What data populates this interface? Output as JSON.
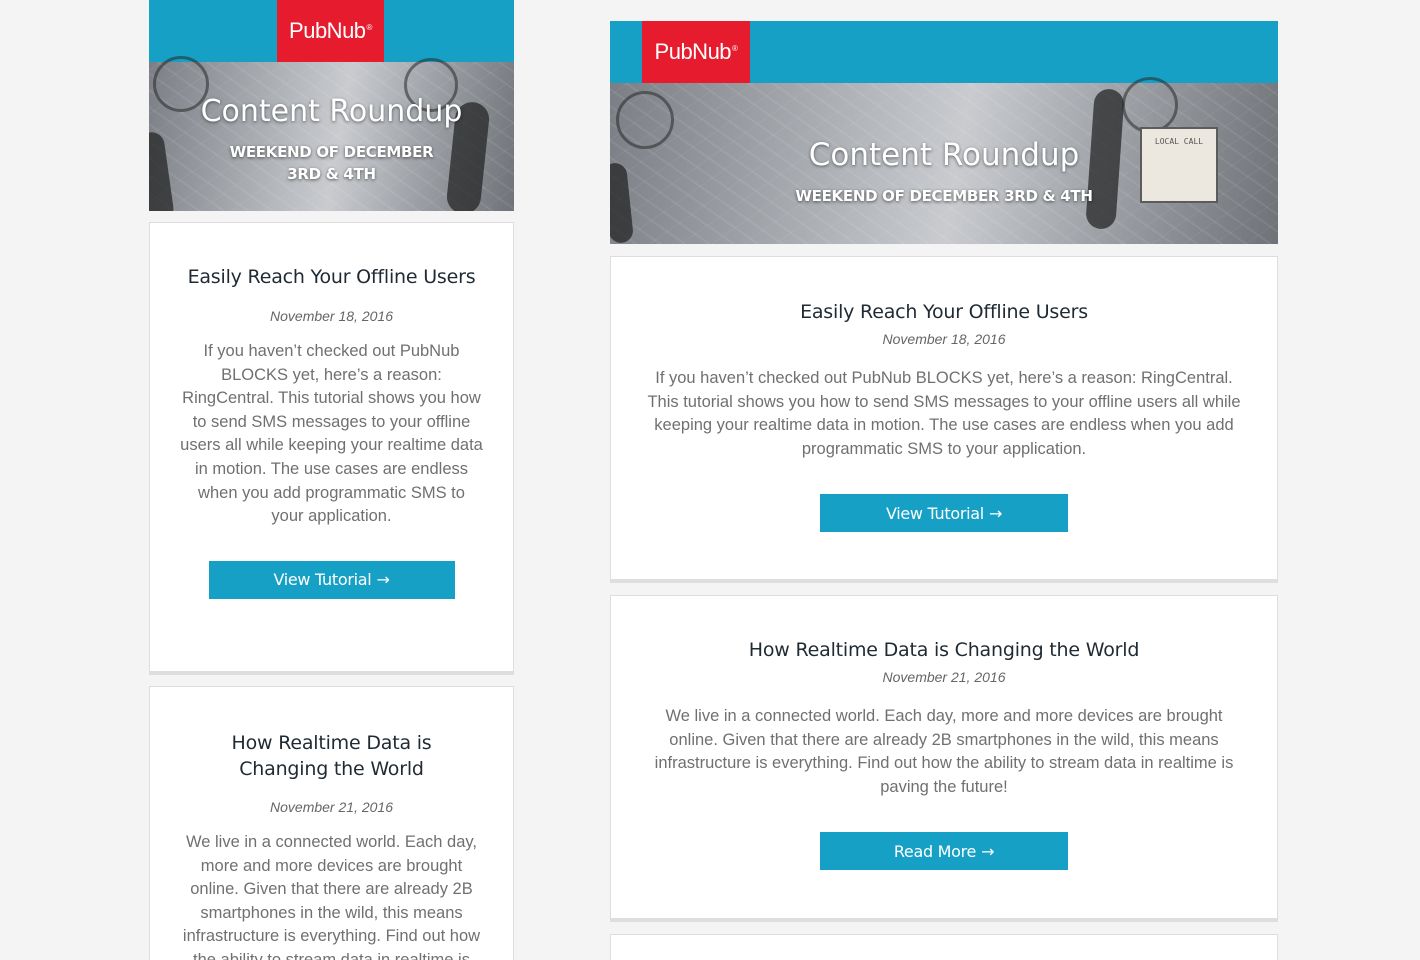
{
  "brand": {
    "logo_text": "PubNub",
    "logo_mark": "®",
    "accent_color": "#17a0c6",
    "logo_color": "#e61c2e"
  },
  "header": {
    "title": "Content Roundup",
    "subtitle_mobile_line1": "WEEKEND OF DECEMBER",
    "subtitle_mobile_line2": "3RD & 4TH",
    "subtitle_desktop": "WEEKEND OF DECEMBER 3RD & 4TH",
    "sign_text": "LOCAL CALL"
  },
  "articles": [
    {
      "title": "Easily Reach Your Offline Users",
      "date": "November 18, 2016",
      "body": "If you haven’t checked out PubNub BLOCKS yet, here’s a reason: RingCentral. This tutorial shows you how to send SMS messages to your offline users all while keeping your realtime data in motion. The use cases are endless when you add programmatic SMS to your application.",
      "button_label": "View Tutorial",
      "button_arrow": "→"
    },
    {
      "title": "How Realtime Data is Changing the World",
      "date": "November 21, 2016",
      "body": "We live in a connected world. Each day, more and more devices are brought online. Given that there are already 2B smartphones in the wild, this means infrastructure is everything. Find out how the ability to stream data in realtime is paving the future!",
      "button_label": "Read More",
      "button_arrow": "→"
    }
  ]
}
